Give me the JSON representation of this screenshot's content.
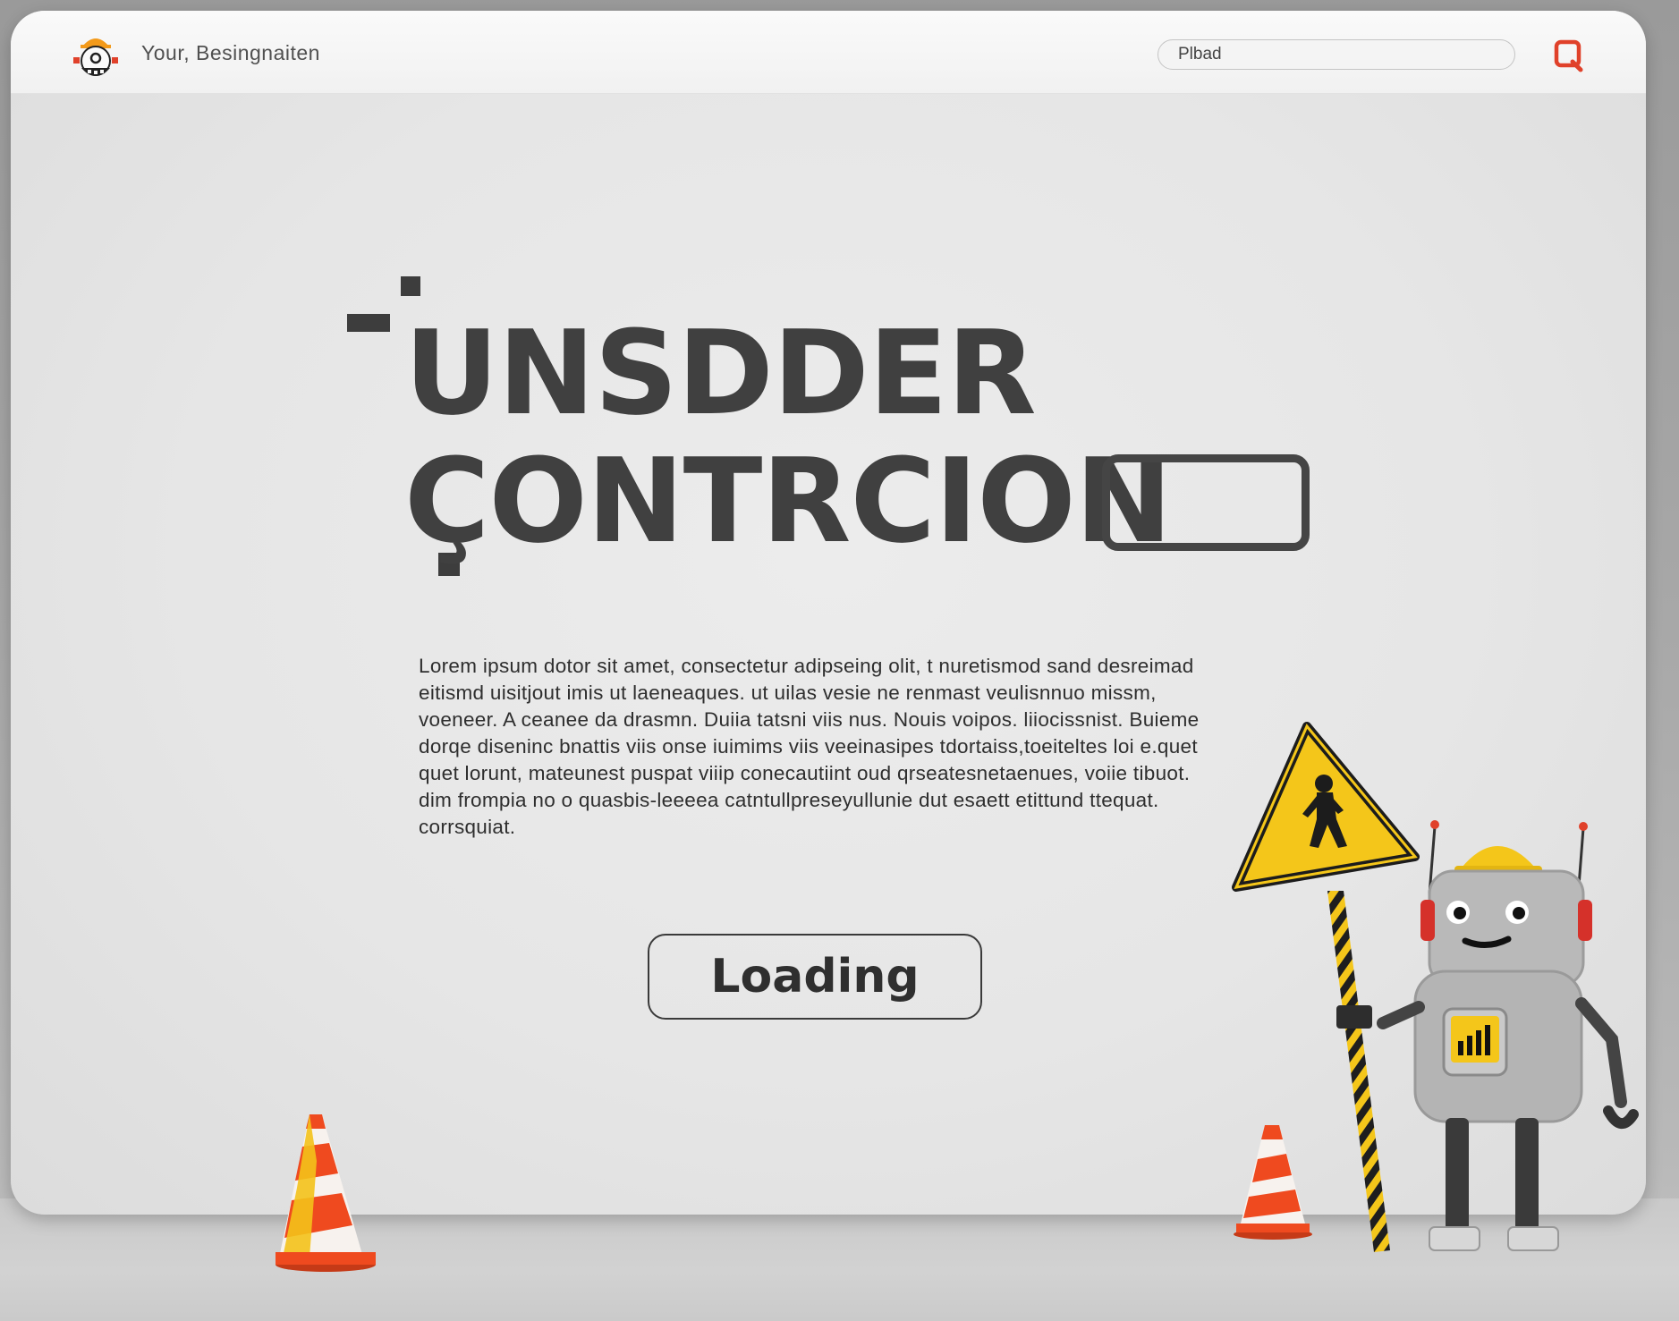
{
  "header": {
    "site_name": "Your, Besingnaiten",
    "search_value": "Plbad"
  },
  "hero": {
    "title_line1": "UNSDDER",
    "title_line2": "ÇONTRCION",
    "body": "Lorem ipsum dotor sit amet, consectetur adipseing olit, t nuretismod sand desreimad eitismd uisitjout imis ut laeneaques. ut uilas vesie ne renmast veulisnnuo missm, voeneer. A ceanee da drasmn. Duiia tatsni viis nus. Nouis voipos. liiocissnist. Buieme dorqe diseninc bnattis viis onse iuimims viis veeinasipes tdortaiss,toeiteltes loi e.quet quet lorunt, mateunest puspat viiip conecautiint oud qrseatesnetaenues, voiie tibuot. dim frompia no o quasbis-leeeea catntullpreseyullunie dut esaett etittund ttequat. corrsquiat."
  },
  "actions": {
    "loading_label": "Loading"
  },
  "colors": {
    "accent_red": "#e0412a",
    "caution_yellow": "#f4c61a",
    "cone_orange": "#ef4a1f",
    "text_dark": "#404040"
  },
  "icons": {
    "logo": "robot-hardhat-logo",
    "search": "search-icon",
    "sign": "pedestrian-warning-sign-icon"
  }
}
